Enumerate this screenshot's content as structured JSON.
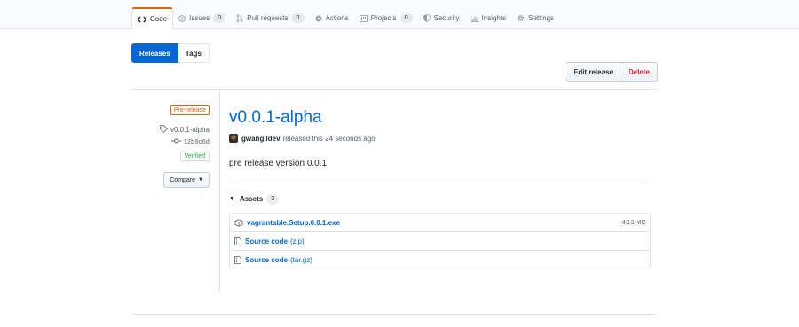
{
  "nav": {
    "tabs": [
      {
        "label": "Code",
        "icon": "code-icon",
        "selected": true
      },
      {
        "label": "Issues",
        "count": "0",
        "icon": "issue-icon"
      },
      {
        "label": "Pull requests",
        "count": "0",
        "icon": "pull-request-icon"
      },
      {
        "label": "Actions",
        "icon": "play-icon"
      },
      {
        "label": "Projects",
        "count": "0",
        "icon": "project-icon"
      },
      {
        "label": "Security",
        "icon": "shield-icon"
      },
      {
        "label": "Insights",
        "icon": "graph-icon"
      },
      {
        "label": "Settings",
        "icon": "gear-icon"
      }
    ]
  },
  "subnav": {
    "releases": "Releases",
    "tags": "Tags"
  },
  "actions": {
    "edit": "Edit release",
    "delete": "Delete"
  },
  "meta": {
    "prerelease": "Pre-release",
    "tag": "v0.0.1-alpha",
    "commit": "12b9c6d",
    "verified": "Verified",
    "compare": "Compare"
  },
  "release": {
    "title": "v0.0.1-alpha",
    "author": "gwangildev",
    "released_text": "released this 24 seconds ago",
    "description": "pre release version 0.0.1"
  },
  "assets": {
    "label": "Assets",
    "count": "3",
    "items": [
      {
        "name": "vagrantable.Setup.0.0.1.exe",
        "suffix": "",
        "size": "43.3 MB",
        "icon": "package-icon"
      },
      {
        "name": "Source code",
        "suffix": "(zip)",
        "size": "",
        "icon": "file-zip-icon"
      },
      {
        "name": "Source code",
        "suffix": "(tar.gz)",
        "size": "",
        "icon": "file-zip-icon"
      }
    ]
  },
  "colors": {
    "accent": "#0366d6",
    "tab_underline": "#e36209",
    "danger": "#cb2431",
    "success": "#28a745"
  }
}
